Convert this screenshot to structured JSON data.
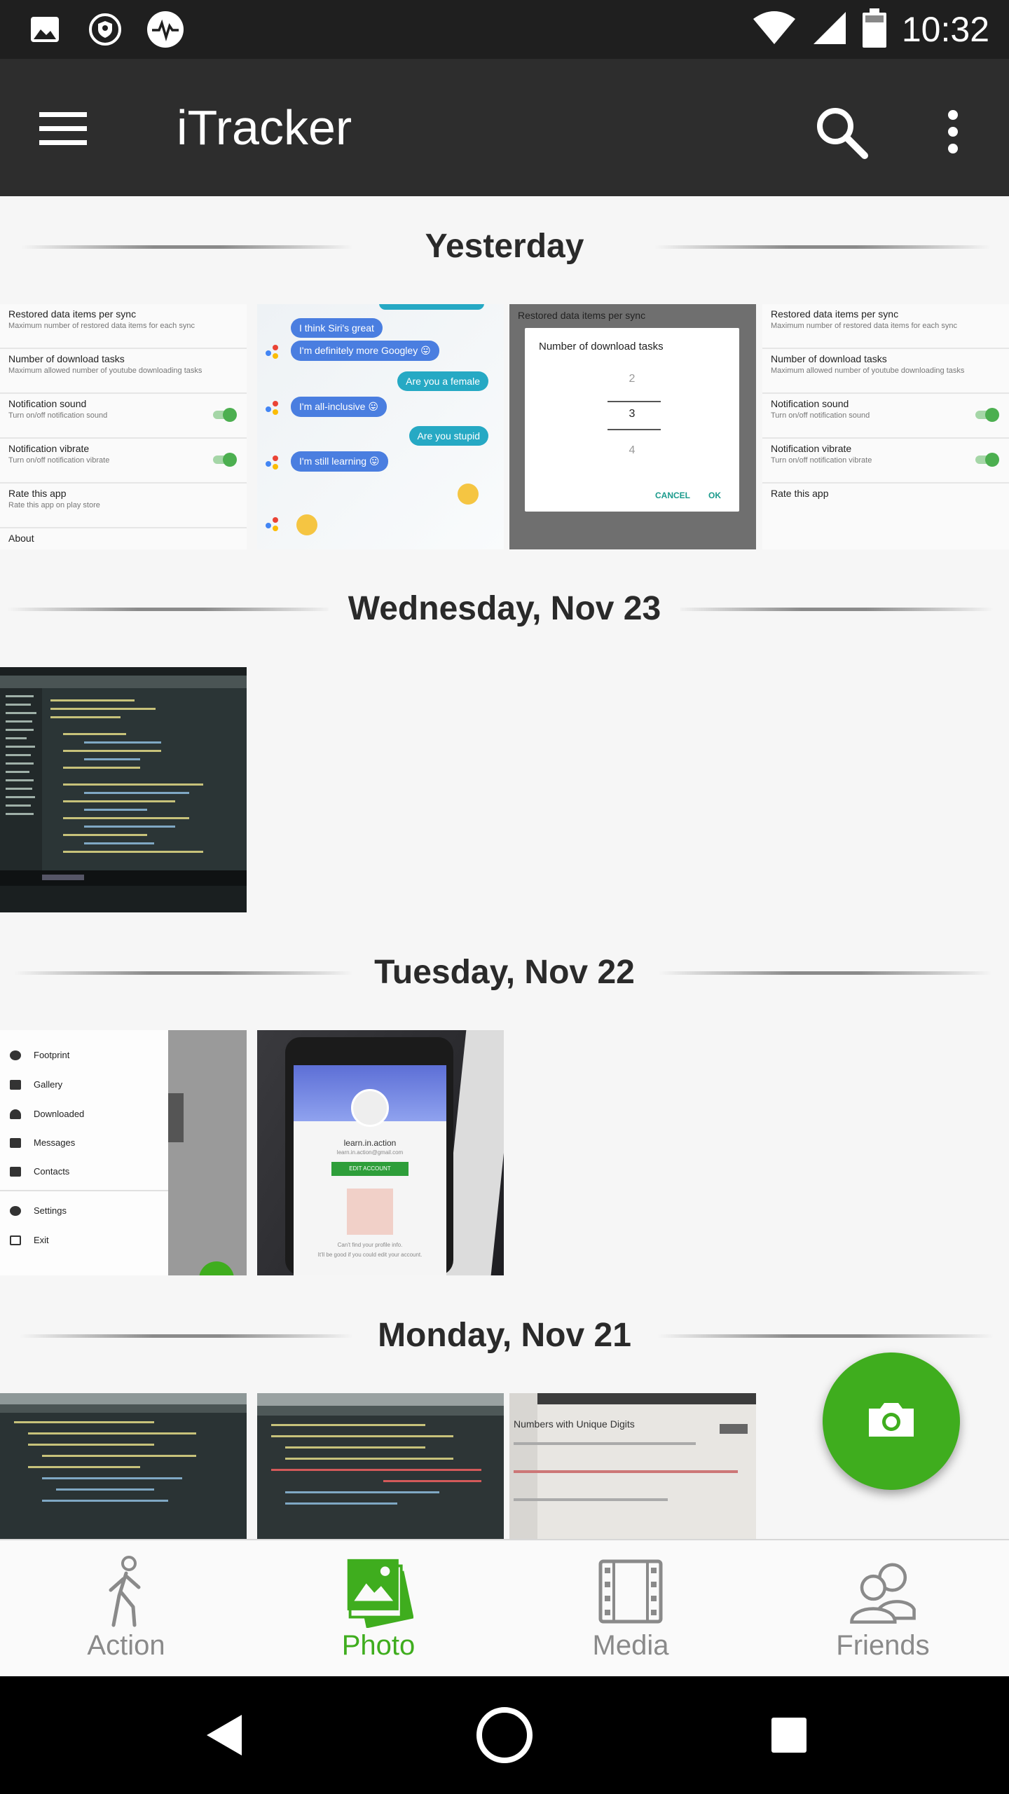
{
  "status_bar": {
    "time": "10:32",
    "left_icons": [
      "image-icon",
      "location-shield-icon",
      "activity-icon"
    ],
    "right_icons": [
      "wifi-icon",
      "signal-icon",
      "battery-icon"
    ]
  },
  "app_bar": {
    "title": "iTracker",
    "menu_icon": "hamburger-menu-icon",
    "search_icon": "search-icon",
    "more_icon": "more-vert-icon"
  },
  "sections": [
    {
      "label": "Yesterday"
    },
    {
      "label": "Wednesday, Nov 23"
    },
    {
      "label": "Tuesday, Nov 22"
    },
    {
      "label": "Monday, Nov 21"
    }
  ],
  "thumbs": {
    "settings_a": {
      "rows": [
        {
          "t": "Restored data items per sync",
          "s": "Maximum number of restored data items for each sync"
        },
        {
          "t": "Number of download tasks",
          "s": "Maximum allowed number of youtube downloading tasks"
        },
        {
          "t": "Notification sound",
          "s": "Turn on/off notification sound"
        },
        {
          "t": "Notification vibrate",
          "s": "Turn on/off notification vibrate"
        },
        {
          "t": "Rate this app",
          "s": "Rate this app on play store"
        },
        {
          "t": "About",
          "s": ""
        }
      ]
    },
    "chat": {
      "messages": [
        "I think Siri's great",
        "I'm definitely more Googley 😛",
        "Are you a female",
        "I'm all-inclusive 😛",
        "Are you stupid",
        "I'm still learning 😛"
      ]
    },
    "dialog": {
      "bg_title": "Restored data items per sync",
      "title": "Number of download tasks",
      "values": [
        "2",
        "3",
        "4"
      ],
      "cancel": "CANCEL",
      "ok": "OK"
    },
    "settings_b": {
      "rows": [
        {
          "t": "Restored data items per sync",
          "s": "Maximum number of restored data items for each sync"
        },
        {
          "t": "Number of download tasks",
          "s": "Maximum allowed number of youtube downloading tasks"
        },
        {
          "t": "Notification sound",
          "s": "Turn on/off notification sound"
        },
        {
          "t": "Notification vibrate",
          "s": "Turn on/off notification vibrate"
        },
        {
          "t": "Rate this app",
          "s": ""
        }
      ]
    },
    "drawer": {
      "items": [
        "Footprint",
        "Gallery",
        "Downloaded",
        "Messages",
        "Contacts",
        "Settings",
        "Exit"
      ]
    },
    "phone": {
      "name": "learn.in.action",
      "email": "learn.in.action@gmail.com",
      "button": "EDIT ACCOUNT",
      "note1": "Can't find your profile info.",
      "note2": "It'll be good if you could edit your account."
    },
    "problem": {
      "title": "Numbers with Unique Digits"
    }
  },
  "fab": {
    "icon": "camera-icon"
  },
  "bottom_nav": {
    "items": [
      {
        "label": "Action",
        "icon": "walking-person-icon",
        "active": false
      },
      {
        "label": "Photo",
        "icon": "photos-icon",
        "active": true
      },
      {
        "label": "Media",
        "icon": "film-strip-icon",
        "active": false
      },
      {
        "label": "Friends",
        "icon": "people-icon",
        "active": false
      }
    ]
  },
  "colors": {
    "accent": "#3fad1e",
    "app_bar": "#2d2d2d",
    "status_bar": "#1f1f1f",
    "inactive_nav": "#8a8a8a"
  }
}
